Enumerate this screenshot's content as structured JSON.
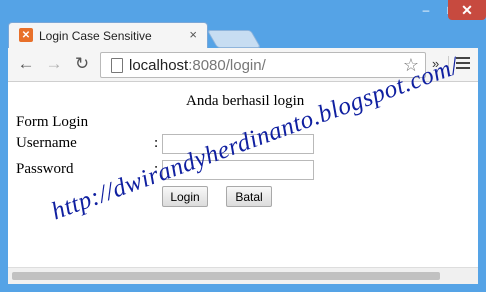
{
  "window": {
    "controls": {
      "minimize": "–",
      "maximize": "□",
      "close": "✕"
    }
  },
  "tab": {
    "icon": "xampp-icon",
    "icon_glyph": "✕",
    "title": "Login Case Sensitive",
    "close": "×"
  },
  "toolbar": {
    "back": "←",
    "forward": "→",
    "reload": "↻",
    "url_host": "localhost",
    "url_rest": ":8080/login/",
    "star": "☆",
    "overflow": "»"
  },
  "page": {
    "success_message": "Anda berhasil login",
    "form_title": "Form Login",
    "username_label": "Username",
    "password_label": "Password",
    "colon": ":",
    "username_value": "",
    "password_value": "",
    "login_button": "Login",
    "cancel_button": "Batal",
    "watermark": "http://dwirandyherdinanto.blogspot.com/"
  },
  "colors": {
    "frame": "#55a3e6",
    "close_button": "#c74a3f",
    "watermark": "#0f1fa0"
  }
}
